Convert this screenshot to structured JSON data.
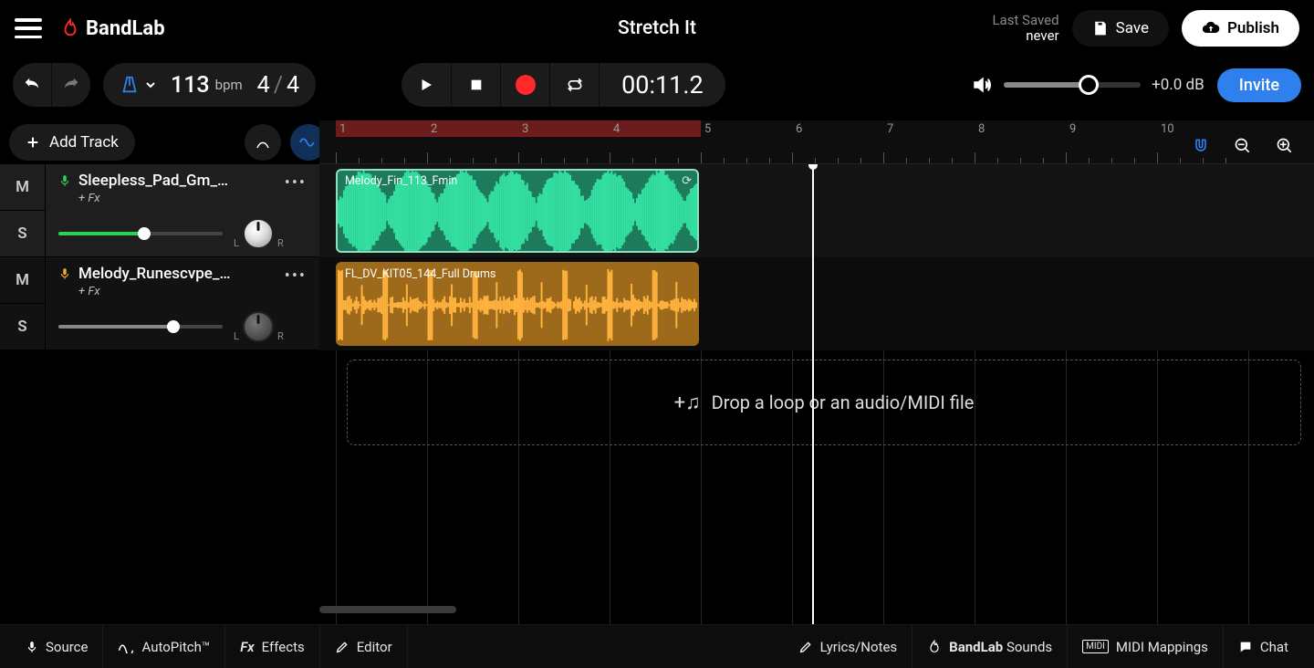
{
  "app": {
    "brand": "BandLab",
    "project_title": "Stretch It"
  },
  "last_saved": {
    "label": "Last Saved",
    "value": "never"
  },
  "buttons": {
    "save": "Save",
    "publish": "Publish",
    "invite": "Invite",
    "add_track": "Add Track"
  },
  "tempo": {
    "value": "113",
    "unit": "bpm"
  },
  "time_sig": {
    "num": "4",
    "den": "4"
  },
  "transport": {
    "timecode": "00:11.2"
  },
  "master": {
    "db": "+0.0 dB"
  },
  "ruler": {
    "bars": [
      "1",
      "2",
      "3",
      "4",
      "5",
      "6",
      "7",
      "8",
      "9",
      "10"
    ]
  },
  "tracks": [
    {
      "name": "Sleepless_Pad_Gm_…",
      "fx": "+ Fx",
      "mute": "M",
      "solo": "S",
      "color": "#2cd158",
      "selected": true,
      "vol_pct": 52
    },
    {
      "name": "Melody_Runescvpe_…",
      "fx": "+ Fx",
      "mute": "M",
      "solo": "S",
      "color": "#f5a623",
      "selected": false,
      "vol_pct": 70
    }
  ],
  "clips": [
    {
      "label": "Melody_Fin_113_Fmin",
      "track": 0
    },
    {
      "label": "FL_DV_KIT05_144_Full Drums",
      "track": 1
    }
  ],
  "dropzone": {
    "text": "Drop a loop or an audio/MIDI file"
  },
  "pan": {
    "left": "L",
    "right": "R"
  },
  "bottom": {
    "left": [
      "Source",
      "AutoPitch™",
      "Effects",
      "Editor"
    ],
    "right": [
      "Lyrics/Notes",
      "BandLab Sounds",
      "MIDI Mappings",
      "Chat"
    ]
  }
}
